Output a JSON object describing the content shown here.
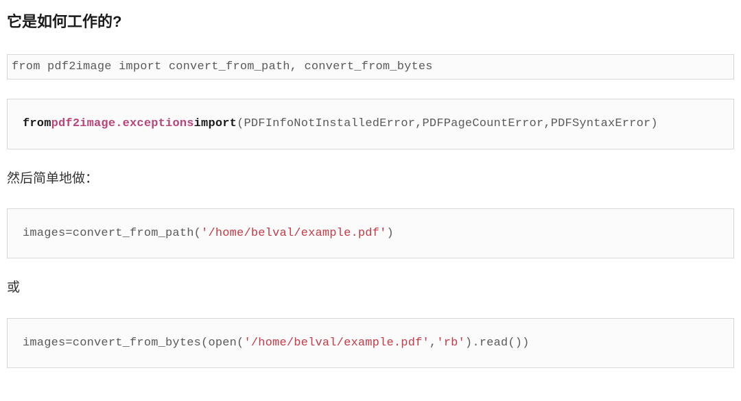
{
  "heading": "它是如何工作的?",
  "code1": {
    "line": "from pdf2image import convert_from_path, convert_from_bytes"
  },
  "code2": {
    "kw_from": "from",
    "mod": "pdf2image.exceptions",
    "kw_import": "import",
    "open_paren": "(",
    "names": "PDFInfoNotInstalledError,PDFPageCountError,PDFSyntaxError",
    "close_paren": ")"
  },
  "para1": "然后简单地做：",
  "code3": {
    "prefix": "images=convert_from_path(",
    "str": "'/home/belval/example.pdf'",
    "suffix": ")"
  },
  "para2": "或",
  "code4": {
    "prefix": "images=convert_from_bytes(open(",
    "str1": "'/home/belval/example.pdf'",
    "comma": ",",
    "str2": "'rb'",
    "suffix": ").read())"
  }
}
